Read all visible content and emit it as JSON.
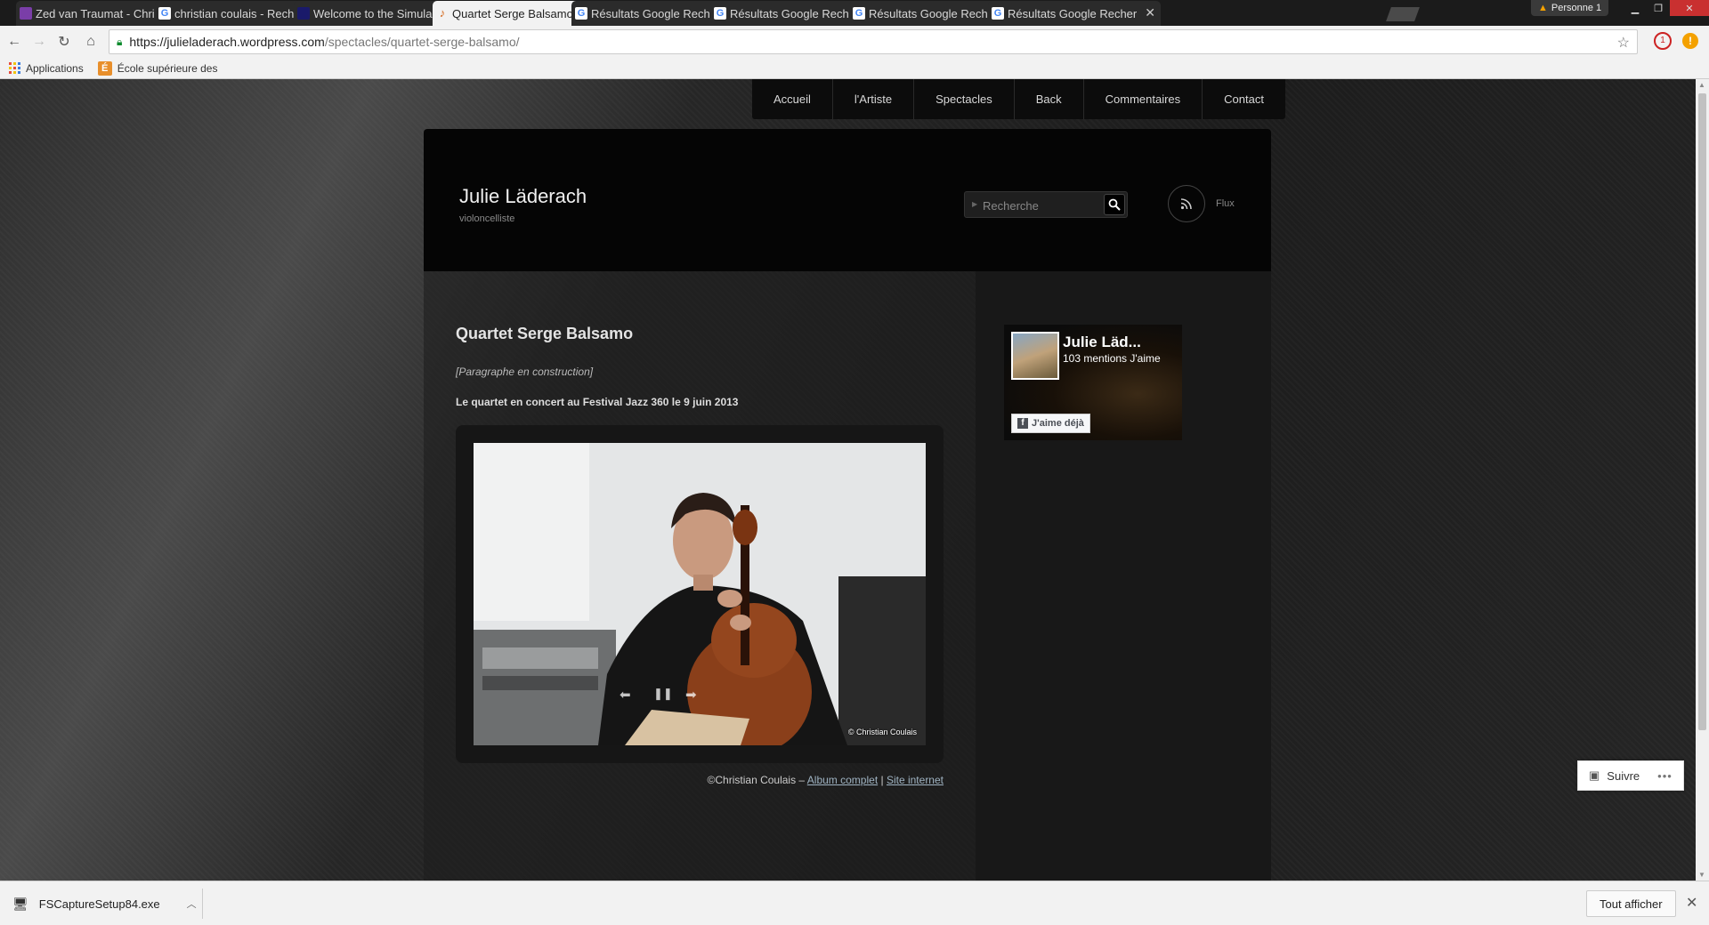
{
  "browser": {
    "tabs": [
      {
        "title": "Zed van Traumat - Christ",
        "favicon_color": "#7a3ea8",
        "active": false
      },
      {
        "title": "christian coulais - Reche",
        "favicon_color": "#4285f4",
        "active": false
      },
      {
        "title": "Welcome to the Simulac",
        "favicon_color": "#1a1a6a",
        "active": false
      },
      {
        "title": "Quartet Serge Balsamo |",
        "favicon_color": "#d4661a",
        "active": true
      },
      {
        "title": "Résultats Google Recher",
        "favicon_color": "#4285f4",
        "active": false
      },
      {
        "title": "Résultats Google Recher",
        "favicon_color": "#4285f4",
        "active": false
      },
      {
        "title": "Résultats Google Recher",
        "favicon_color": "#4285f4",
        "active": false
      },
      {
        "title": "Résultats Google Recher",
        "favicon_color": "#4285f4",
        "active": false
      }
    ],
    "profile": "Personne 1",
    "url_prefix": "https://",
    "url_host": "julieladerach.wordpress.com",
    "url_path": "/spectacles/quartet-serge-balsamo/",
    "bookmarks": [
      {
        "label": "Applications"
      },
      {
        "label": "École supérieure des"
      }
    ],
    "ext_badge": "1"
  },
  "site": {
    "nav": [
      "Accueil",
      "l'Artiste",
      "Spectacles",
      "Back",
      "Commentaires",
      "Contact"
    ],
    "title": "Julie Läderach",
    "tagline": "violoncelliste",
    "search_placeholder": "Recherche",
    "feed_label": "Flux"
  },
  "post": {
    "title": "Quartet Serge Balsamo",
    "paragraph_note": "[Paragraphe en construction]",
    "concert_line": "Le quartet en concert au Festival Jazz 360 le 9 juin 2013",
    "photo_credit_badge": "© Christian Coulais",
    "credit_text": "©Christian Coulais – ",
    "album_link": "Album complet",
    "separator": " | ",
    "site_link": "Site internet"
  },
  "facebook": {
    "name": "Julie Läd...",
    "likes": "103 mentions J'aime",
    "button": "J'aime déjà"
  },
  "follow_button": "Suivre",
  "download_bar": {
    "file": "FSCaptureSetup84.exe",
    "show_all": "Tout afficher"
  }
}
